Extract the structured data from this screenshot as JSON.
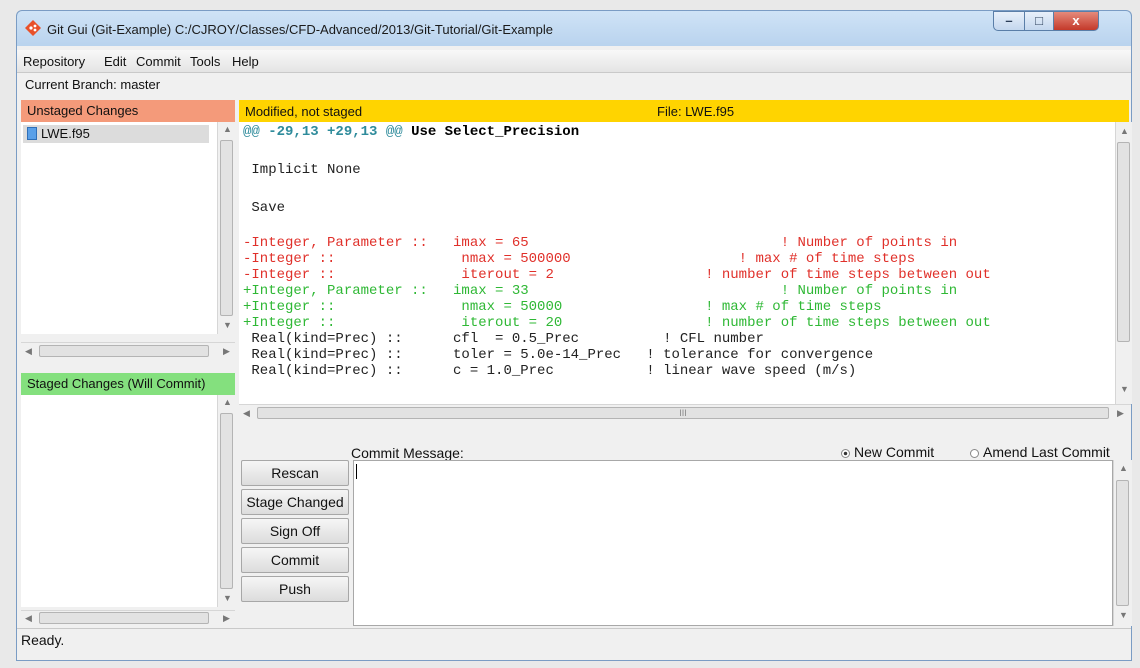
{
  "window": {
    "title": "Git Gui (Git-Example) C:/CJROY/Classes/CFD-Advanced/2013/Git-Tutorial/Git-Example",
    "app_icon": "git-diamond-icon",
    "controls": {
      "minimize": "–",
      "maximize": "□",
      "close": "x"
    }
  },
  "menubar": {
    "items": [
      "Repository",
      "Edit",
      "Commit",
      "Tools",
      "Help"
    ]
  },
  "branch": "Current Branch: master",
  "unstaged": {
    "header": "Unstaged Changes",
    "header_color": "#f49a7a",
    "files": [
      {
        "name": "LWE.f95",
        "icon": "file-icon"
      }
    ]
  },
  "staged": {
    "header": "Staged Changes (Will Commit)",
    "header_color": "#84e07e",
    "files": []
  },
  "diff": {
    "status": "Modified, not staged",
    "file": "File: LWE.f95",
    "header_color": "#ffd400",
    "hunk": {
      "at1": "@@",
      "range": "-29,13 +29,13",
      "at2": "@@",
      "context": "Use Select_Precision"
    },
    "lines": [
      {
        "type": "ctx",
        "text": " Implicit None"
      },
      {
        "type": "blank",
        "text": ""
      },
      {
        "type": "ctx",
        "text": " Save"
      },
      {
        "type": "blank",
        "text": ""
      },
      {
        "type": "del",
        "text": "-Integer, Parameter ::   imax = 65                              ! Number of points in"
      },
      {
        "type": "del",
        "text": "-Integer ::               nmax = 500000                    ! max # of time steps"
      },
      {
        "type": "del",
        "text": "-Integer ::               iterout = 2                  ! number of time steps between out"
      },
      {
        "type": "add",
        "text": "+Integer, Parameter ::   imax = 33                              ! Number of points in"
      },
      {
        "type": "add",
        "text": "+Integer ::               nmax = 50000                 ! max # of time steps"
      },
      {
        "type": "add",
        "text": "+Integer ::               iterout = 20                 ! number of time steps between out"
      },
      {
        "type": "ctx",
        "text": " Real(kind=Prec) ::      cfl  = 0.5_Prec          ! CFL number"
      },
      {
        "type": "ctx",
        "text": " Real(kind=Prec) ::      toler = 5.0e-14_Prec   ! tolerance for convergence"
      },
      {
        "type": "ctx",
        "text": " Real(kind=Prec) ::      c = 1.0_Prec           ! linear wave speed (m/s)"
      }
    ],
    "hscroll_mark": "III"
  },
  "commit": {
    "label": "Commit Message:",
    "new_commit": "New Commit",
    "amend": "Amend Last Commit",
    "message": "",
    "buttons": [
      "Rescan",
      "Stage Changed",
      "Sign Off",
      "Commit",
      "Push"
    ]
  },
  "status": "Ready."
}
